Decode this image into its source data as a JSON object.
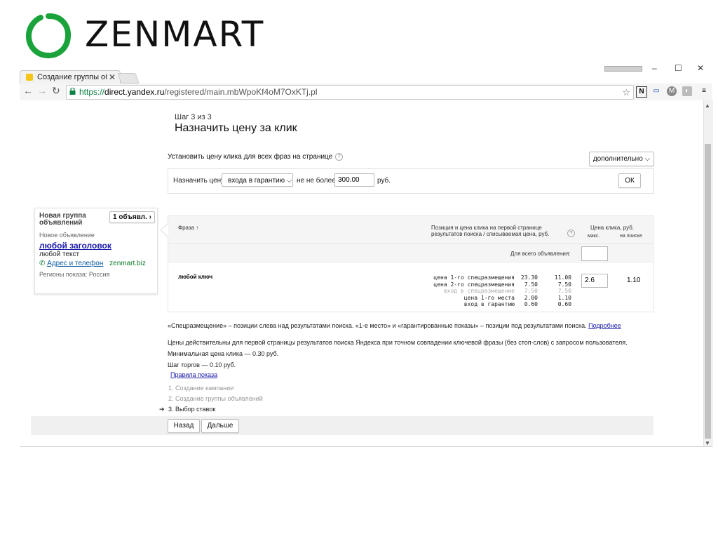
{
  "logo": {
    "text": "ZENMART",
    "ring_color": "#1aa33a"
  },
  "browser": {
    "tab_title": "Создание группы объяв",
    "tab_close": "✕",
    "window_controls": [
      "–",
      "☐",
      "✕"
    ],
    "url_scheme": "https://",
    "url_host": "direct.yandex.ru",
    "url_path": "/registered/main.mbWpoKf4oM7OxKTj.pl",
    "extensions": [
      "N",
      "▭",
      "M",
      "◐",
      "≡"
    ]
  },
  "page": {
    "step": "Шаг 3 из 3",
    "title": "Назначить цену за клик",
    "section_title": "Установить цену клика для всех фраз на странице",
    "help": "?",
    "extra_button": "дополнительно",
    "set_price_label": "Назначить цену",
    "strategy_select": "входа в гарантию",
    "max_label": "не не более",
    "price_value": "300.00",
    "currency": "руб.",
    "ok_button": "ОК"
  },
  "card": {
    "group_title_1": "Новая группа",
    "group_title_2": "объявлений",
    "count_button": "1 объявл.",
    "new_ad": "Новое объявление",
    "ad_title": "любой заголовок",
    "ad_text": "любой текст",
    "contact_link": "Адрес и телефон",
    "domain": "zenmart.biz",
    "regions": "Регионы показа: Россия"
  },
  "table": {
    "col_phrase": "Фраза ↑",
    "col_position_1": "Позиция и цена клика на первой странице",
    "col_position_2": "результатов поиска / списываемая цена, руб.",
    "col_price": "Цена клика, руб.",
    "col_max": "макс.",
    "col_on_search": "на поиске",
    "all_label": "Для всего объявления:",
    "rows": [
      {
        "phrase": "любой ключ",
        "positions": [
          {
            "label": "цена 1-го спецразмещения",
            "bid": "23.30",
            "charge": "11.00",
            "muted": false
          },
          {
            "label": "цена 2-го спецразмещения",
            "bid": "7.50",
            "charge": "7.50",
            "muted": false
          },
          {
            "label": "вход в спецразмещение",
            "bid": "7.50",
            "charge": "7.50",
            "muted": true
          },
          {
            "label": "цена 1-го места",
            "bid": "2.00",
            "charge": "1.10",
            "muted": false
          },
          {
            "label": "вход в гарантию",
            "bid": "0.60",
            "charge": "0.60",
            "muted": false
          }
        ],
        "max_value": "2.6",
        "on_search": "1.10"
      }
    ]
  },
  "notes": {
    "line1": "«Спецразмещение» – позиции слева над результатами поиска. «1-е место» и «гарантированные показы» – позиции под результатами поиска.",
    "line1_link": "Подробнее",
    "line2": "Цены действительны для первой страницы результатов поиска Яндекса при точном совпадении ключевой фразы (без стоп-слов) с запросом пользователя.",
    "line3": "Минимальная цена клика — 0.30 руб.",
    "line4": "Шаг торгов — 0.10 руб.",
    "rules_link": "Правила показа"
  },
  "steps": [
    {
      "label": "1. Создание кампании",
      "current": false
    },
    {
      "label": "2. Создание группы объявлений",
      "current": false
    },
    {
      "label": "3. Выбор ставок",
      "current": true
    }
  ],
  "current_marker": "➔",
  "buttons": {
    "back": "Назад",
    "next": "Дальше"
  }
}
